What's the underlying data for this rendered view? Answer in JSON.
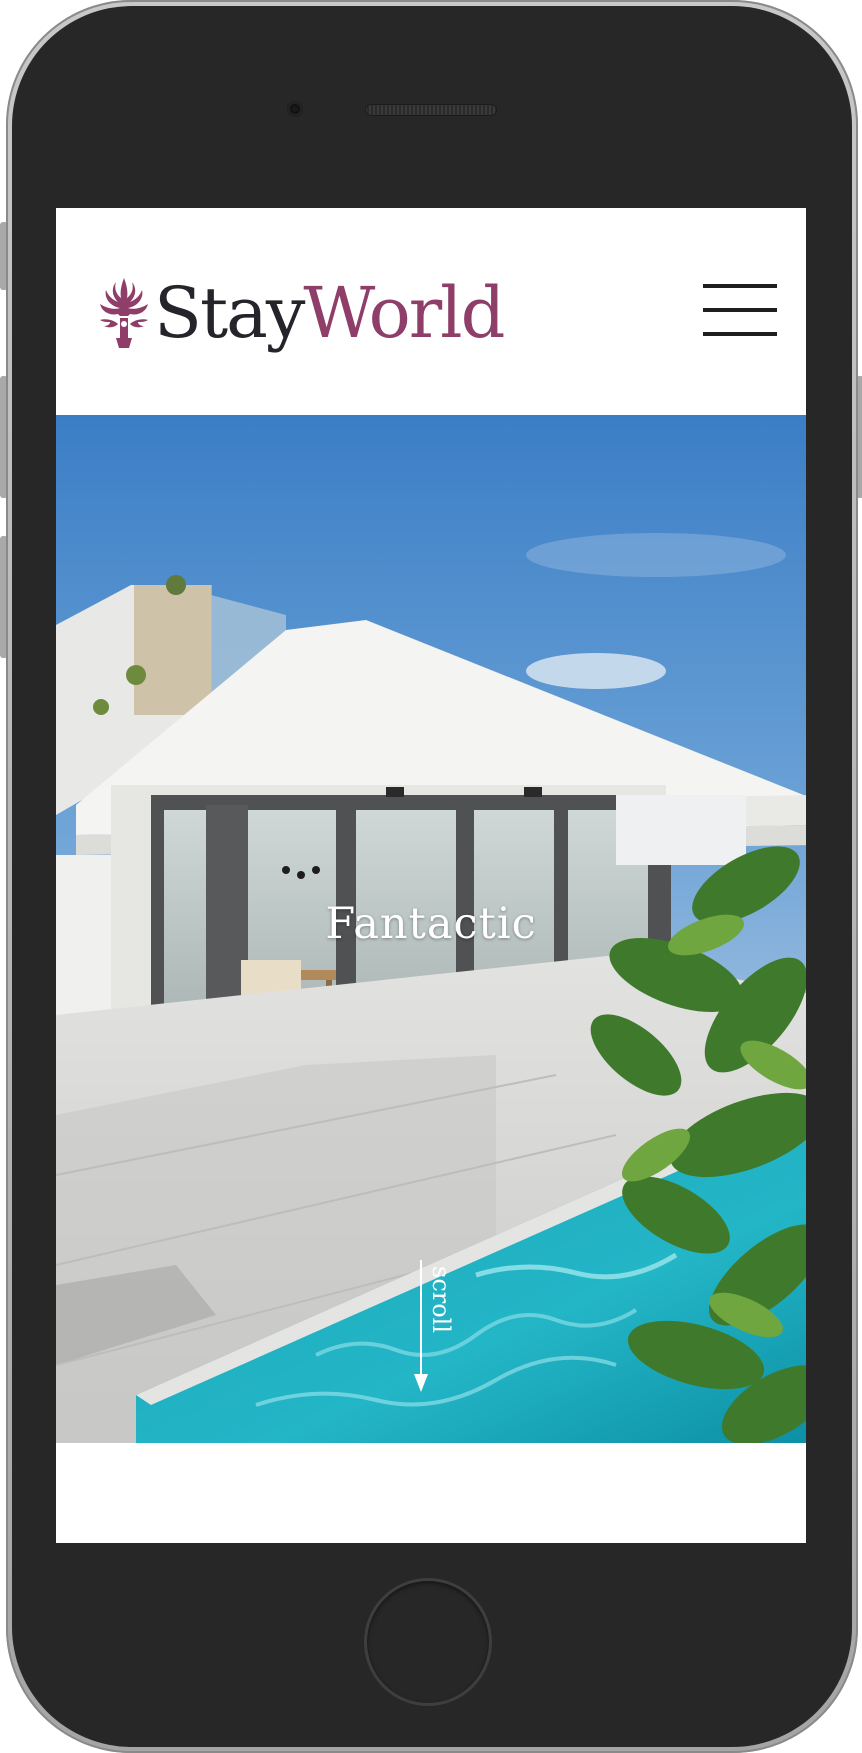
{
  "header": {
    "logo_part1": "Stay",
    "logo_part2": "World",
    "logo_icon": "fleur-ornament-icon",
    "menu_icon": "hamburger-menu-icon"
  },
  "hero": {
    "title": "Fantactic",
    "scroll_label": "scroll",
    "scroll_icon": "arrow-down-icon"
  },
  "colors": {
    "brand_dark": "#24242a",
    "brand_accent": "#8e3e68",
    "device_body": "#272727"
  }
}
